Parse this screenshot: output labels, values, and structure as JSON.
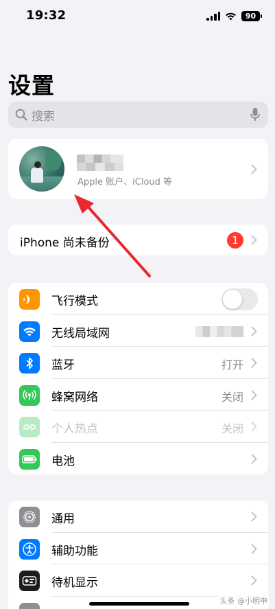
{
  "status_bar": {
    "time": "19:32",
    "battery": "90"
  },
  "title": "设置",
  "search": {
    "placeholder": "搜索"
  },
  "profile": {
    "subtitle": "Apple 账户、iCloud 等"
  },
  "backup": {
    "label": "iPhone 尚未备份",
    "badge": "1"
  },
  "group1": [
    {
      "label": "飞行模式",
      "value": "",
      "icon": "airplane-icon",
      "color": "#ff9500"
    },
    {
      "label": "无线局域网",
      "value": "",
      "icon": "wifi-icon",
      "color": "#007aff"
    },
    {
      "label": "蓝牙",
      "value": "打开",
      "icon": "bluetooth-icon",
      "color": "#007aff"
    },
    {
      "label": "蜂窝网络",
      "value": "关闭",
      "icon": "cellular-icon",
      "color": "#34c759"
    },
    {
      "label": "个人热点",
      "value": "关闭",
      "icon": "hotspot-icon",
      "color": "#34c759"
    },
    {
      "label": "电池",
      "value": "",
      "icon": "battery-icon",
      "color": "#34c759"
    }
  ],
  "group2": [
    {
      "label": "通用",
      "icon": "gear-icon",
      "color": "#8e8e93"
    },
    {
      "label": "辅助功能",
      "icon": "accessibility-icon",
      "color": "#007aff"
    },
    {
      "label": "待机显示",
      "icon": "standby-icon",
      "color": "#1c1c1e"
    },
    {
      "label": "",
      "icon": "partial-row-icon",
      "color": "#8e8e93"
    }
  ],
  "airplane_toggle": {
    "on": false
  },
  "watermark": "头条 @小明申"
}
